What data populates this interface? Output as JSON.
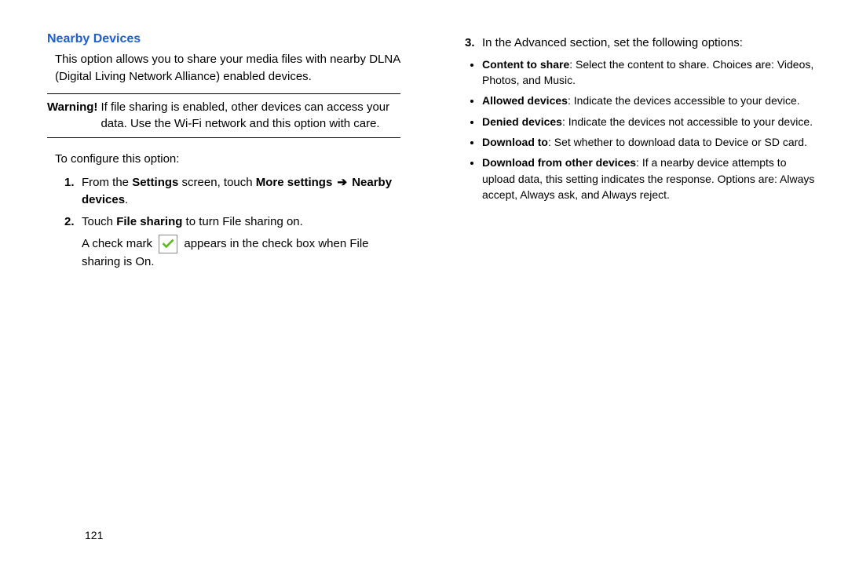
{
  "left": {
    "heading": "Nearby Devices",
    "intro": "This option allows you to share your media files with nearby DLNA (Digital Living Network Alliance) enabled devices.",
    "warning_label": "Warning!",
    "warning_text": "If file sharing is enabled, other devices can access your data. Use the Wi-Fi network and this option with care.",
    "configure_label": "To configure this option:",
    "step1_pre": "From the ",
    "step1_b1": "Settings",
    "step1_mid": " screen, touch ",
    "step1_b2": "More settings",
    "step1_b3": "Nearby devices",
    "step1_end": ".",
    "step2_pre": "Touch ",
    "step2_b": "File sharing",
    "step2_post": " to turn File sharing on.",
    "step2_extra_pre": "A check mark ",
    "step2_extra_post": " appears in the check box when File sharing is On."
  },
  "right": {
    "step3": "In the Advanced section, set the following options:",
    "bullets": [
      {
        "name": "Content to share",
        "text": ": Select the content to share. Choices are: Videos, Photos, and Music."
      },
      {
        "name": "Allowed devices",
        "text": ": Indicate the devices accessible to your device."
      },
      {
        "name": "Denied devices",
        "text": ": Indicate the devices not accessible to your device."
      },
      {
        "name": "Download to",
        "text": ": Set whether to download data to Device or SD card."
      },
      {
        "name": "Download from other devices",
        "text": ": If a nearby device attempts to upload data, this setting indicates the response. Options are: Always accept, Always ask, and Always reject."
      }
    ]
  },
  "page_number": "121"
}
